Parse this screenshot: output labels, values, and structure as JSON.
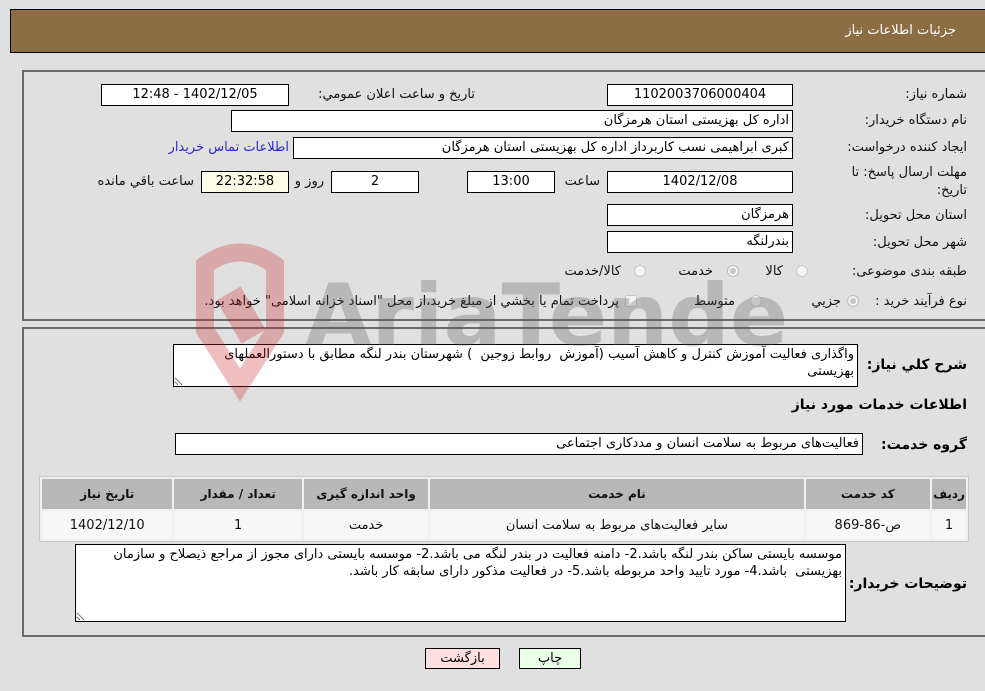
{
  "header": {
    "title": "جزئیات اطلاعات نیاز"
  },
  "form": {
    "need_number": {
      "label": "شماره نیاز:",
      "value": "1102003706000404"
    },
    "announce_datetime": {
      "label": "تاريخ و ساعت اعلان عمومي:",
      "value": "1402/12/05 - 12:48"
    },
    "buyer_org": {
      "label": "نام دستگاه خريدار:",
      "value": "اداره کل بهزیستی استان هرمزگان"
    },
    "requester": {
      "label": "ايجاد کننده درخواست:",
      "value": "کبری  ابراهیمی نسب کاربرداز اداره کل بهزیستی استان هرمزگان"
    },
    "contact_link": "اطلاعات تماس خريدار",
    "deadline": {
      "label_line1": "مهلت ارسال پاسخ: تا",
      "label_line2": "تاريخ:",
      "date": "1402/12/08",
      "time_label": "ساعت",
      "time": "13:00",
      "days": "2",
      "days_label": "روز و",
      "remaining": "22:32:58",
      "remaining_label": "ساعت باقي مانده"
    },
    "province": {
      "label": "استان محل تحويل:",
      "value": "هرمزگان"
    },
    "city": {
      "label": "شهر محل تحويل:",
      "value": "بندرلنگه"
    },
    "category": {
      "label": "طبقه بندی موضوعی:",
      "options": [
        {
          "label": "کالا",
          "checked": false
        },
        {
          "label": "خدمت",
          "checked": true
        },
        {
          "label": "کالا/خدمت",
          "checked": false
        }
      ]
    },
    "purchase_type": {
      "label": "نوع فرآيند خريد :",
      "options": [
        {
          "label": "جزيي",
          "checked": true
        },
        {
          "label": "متوسط",
          "checked": false
        }
      ],
      "treasury_checkbox_label": "پرداخت تمام يا بخشي از مبلغ خريد،از محل \"اسناد خزانه اسلامی\" خواهد بود.",
      "treasury_checked": false
    }
  },
  "details": {
    "description_label": "شرح كلي نياز:",
    "description": "واگذاری فعالیت آموزش کنترل و کاهش آسیب (آموزش  روابط زوجین  ) شهرستان بندر لنگه مطابق با دستورالعملهای بهزیستی",
    "services_title": "اطلاعات خدمات مورد نياز",
    "service_group_label": "گروه خدمت:",
    "service_group": "فعالیت‌های مربوط به سلامت انسان و مددکاری اجتماعی",
    "table": {
      "headers": [
        "رديف",
        "کد خدمت",
        "نام خدمت",
        "واحد اندازه گيری",
        "تعداد / مقدار",
        "تاريخ نياز"
      ],
      "rows": [
        [
          "1",
          "ص-86-869",
          "سایر فعالیت‌های مربوط به سلامت انسان",
          "خدمت",
          "1",
          "1402/12/10"
        ]
      ]
    },
    "buyer_notes_label": "توضيحات خريدار:",
    "buyer_notes": "موسسه بایستی ساکن بندر لنگه باشد.2- دامنه فعالیت در بندر لنگه می باشد.2- موسسه بایستی دارای مجوز از مراجع ذیصلاح و سازمان بهزیستی  باشد.4- مورد تایید واحد مربوطه باشد.5- در فعالیت مذکور دارای سابقه کار باشد."
  },
  "buttons": {
    "print": "چاپ",
    "back": "بازگشت"
  },
  "watermark": {
    "text": "AriaTender.neT",
    "color": "#c81e1e"
  }
}
